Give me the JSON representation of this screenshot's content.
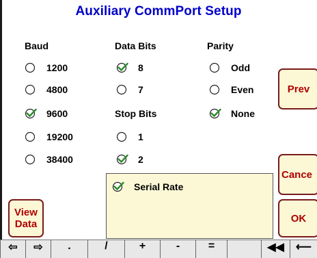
{
  "header": {
    "title": "Auxiliary CommPort Setup"
  },
  "baud": {
    "label": "Baud",
    "options": [
      {
        "label": "1200",
        "checked": false
      },
      {
        "label": "4800",
        "checked": false
      },
      {
        "label": "9600",
        "checked": true
      },
      {
        "label": "19200",
        "checked": false
      },
      {
        "label": "38400",
        "checked": false
      }
    ]
  },
  "data_bits": {
    "label": "Data Bits",
    "options": [
      {
        "label": "8",
        "checked": true
      },
      {
        "label": "7",
        "checked": false
      }
    ]
  },
  "stop_bits": {
    "label": "Stop Bits",
    "options": [
      {
        "label": "1",
        "checked": false
      },
      {
        "label": "2",
        "checked": true
      }
    ]
  },
  "parity": {
    "label": "Parity",
    "options": [
      {
        "label": "Odd",
        "checked": false
      },
      {
        "label": "Even",
        "checked": false
      },
      {
        "label": "None",
        "checked": true
      }
    ]
  },
  "serial_rate": {
    "label": "Serial Rate",
    "checked": true
  },
  "buttons": {
    "prev": "Prev",
    "cancel": "Cance",
    "ok": "OK",
    "view_data_line1": "View",
    "view_data_line2": "Data"
  },
  "keyboard": {
    "keys": [
      "⇦",
      "⇨",
      ".",
      "/",
      "+",
      "-",
      "=",
      "",
      "◀◀",
      "⟵"
    ]
  },
  "colors": {
    "title": "#0000c8",
    "button_text": "#b00000",
    "button_fill": "#fcf8d6",
    "check": "#2a8a2a"
  }
}
